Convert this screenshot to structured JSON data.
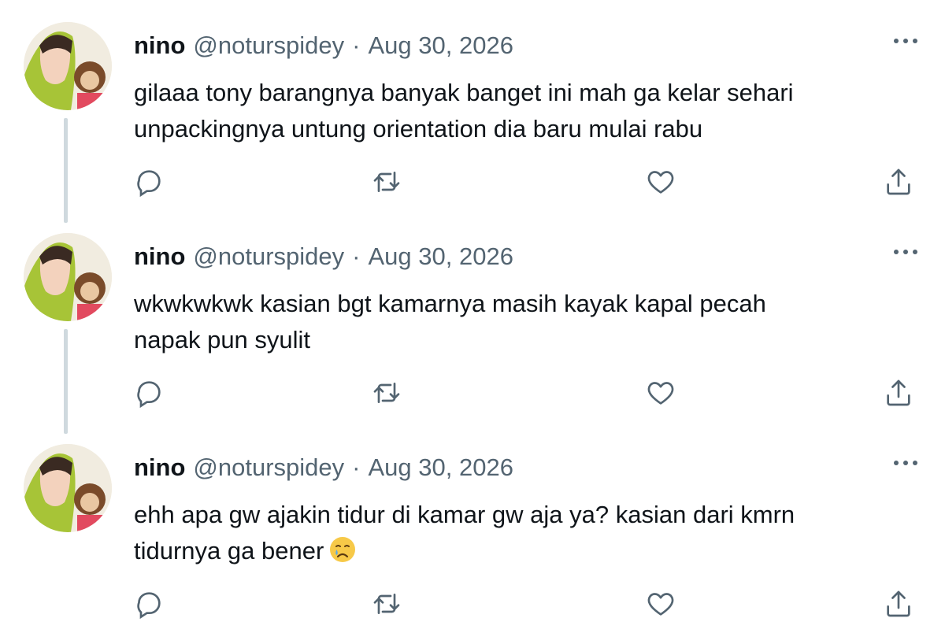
{
  "colors": {
    "text": "#0f1419",
    "secondary": "#536471",
    "thread": "#cfd9de",
    "icon": "#536471"
  },
  "icons": {
    "more": "more-horizontal-icon",
    "reply": "reply-icon",
    "retweet": "retweet-icon",
    "like": "heart-icon",
    "share": "share-icon",
    "emoji": "crying-face-emoji"
  },
  "tweets": [
    {
      "name": "nino",
      "handle": "@noturspidey",
      "separator": "·",
      "date": "Aug 30, 2026",
      "lines": [
        "gilaaa tony barangnya banyak banget ini mah ga kelar sehari",
        "unpackingnya untung orientation dia baru mulai rabu"
      ]
    },
    {
      "name": "nino",
      "handle": "@noturspidey",
      "separator": "·",
      "date": "Aug 30, 2026",
      "lines": [
        "wkwkwkwk kasian bgt kamarnya masih kayak kapal pecah",
        "napak pun syulit"
      ]
    },
    {
      "name": "nino",
      "handle": "@noturspidey",
      "separator": "·",
      "date": "Aug 30, 2026",
      "lines": [
        "ehh apa gw ajakin tidur di kamar gw aja ya? kasian dari kmrn",
        "tidurnya ga bener"
      ]
    }
  ]
}
